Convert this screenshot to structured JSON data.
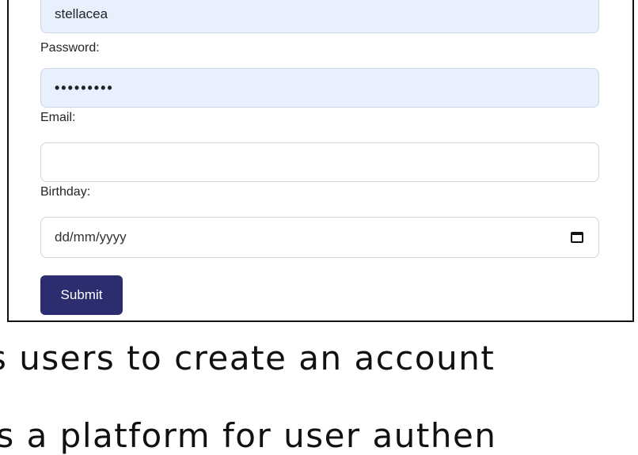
{
  "form": {
    "username_value": "stellacea",
    "password_label": "Password:",
    "password_value": "•••••••••",
    "email_label": "Email:",
    "email_value": "",
    "birthday_label": "Birthday:",
    "birthday_placeholder": "dd/mm/yyyy",
    "submit_label": "Submit"
  },
  "caption": {
    "line1": "s users to create an account",
    "line2": "es a platform for user authen"
  },
  "colors": {
    "autofill_bg": "#e8f0fe",
    "submit_bg": "#2b2d6e"
  },
  "icons": {
    "birthday_picker": "calendar-icon"
  }
}
